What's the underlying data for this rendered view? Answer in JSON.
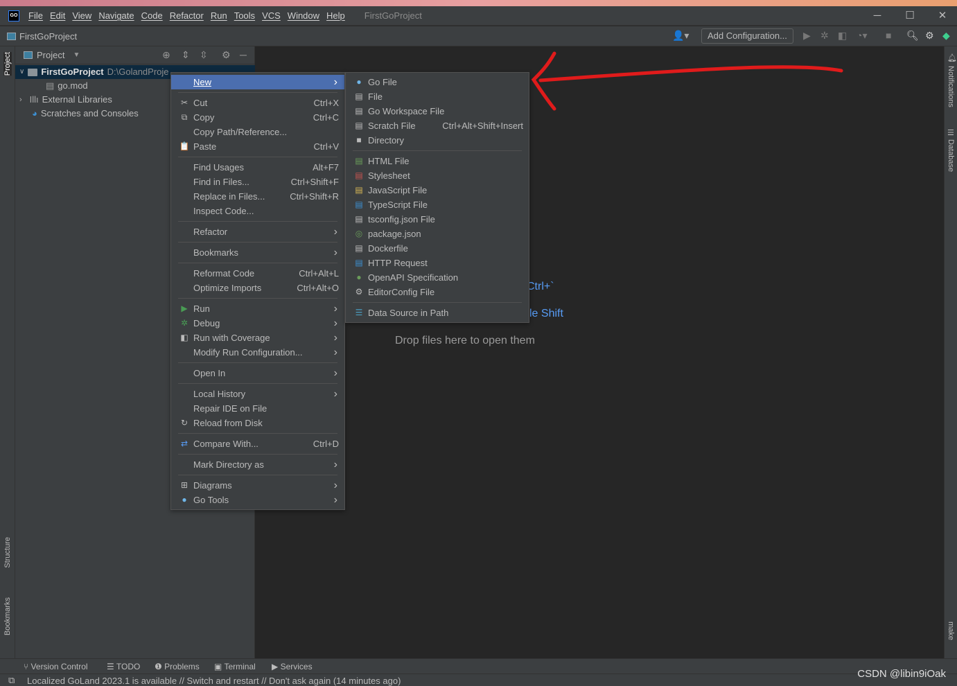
{
  "app": {
    "logo_text": "GO",
    "window_title": "FirstGoProject",
    "accent": "#4b6eaf",
    "annotation_color": "#e01b1b"
  },
  "menubar": [
    "File",
    "Edit",
    "View",
    "Navigate",
    "Code",
    "Refactor",
    "Run",
    "Tools",
    "VCS",
    "Window",
    "Help"
  ],
  "navbar": {
    "project": "FirstGoProject",
    "add_configuration": "Add Configuration..."
  },
  "left_strip": {
    "project": "Project",
    "structure": "Structure",
    "bookmarks": "Bookmarks"
  },
  "right_strip": {
    "notifications": "Notifications",
    "database": "Database",
    "make": "make"
  },
  "project_panel": {
    "title": "Project",
    "tree": [
      {
        "label": "FirstGoProject",
        "path": "D:\\GolandProje",
        "icon": "folder-icon",
        "expanded": true
      },
      {
        "label": "go.mod",
        "icon": "file-icon"
      },
      {
        "label": "External Libraries",
        "icon": "library-icon",
        "expanded": false
      },
      {
        "label": "Scratches and Consoles",
        "icon": "scratches-icon"
      }
    ]
  },
  "context_menu": [
    {
      "label": "New",
      "ul": "N",
      "arrow": true,
      "selected": true
    },
    {
      "sep": true
    },
    {
      "label": "Cut",
      "icon": "✂",
      "name": "cut",
      "shortcut": "Ctrl+X"
    },
    {
      "label": "Copy",
      "icon": "⧉",
      "name": "copy",
      "shortcut": "Ctrl+C"
    },
    {
      "label": "Copy Path/Reference..."
    },
    {
      "label": "Paste",
      "icon": "📋",
      "name": "paste",
      "shortcut": "Ctrl+V"
    },
    {
      "sep": true
    },
    {
      "label": "Find Usages",
      "shortcut": "Alt+F7"
    },
    {
      "label": "Find in Files...",
      "shortcut": "Ctrl+Shift+F"
    },
    {
      "label": "Replace in Files...",
      "shortcut": "Ctrl+Shift+R"
    },
    {
      "label": "Inspect Code..."
    },
    {
      "sep": true
    },
    {
      "label": "Refactor",
      "arrow": true
    },
    {
      "sep": true
    },
    {
      "label": "Bookmarks",
      "arrow": true
    },
    {
      "sep": true
    },
    {
      "label": "Reformat Code",
      "shortcut": "Ctrl+Alt+L"
    },
    {
      "label": "Optimize Imports",
      "shortcut": "Ctrl+Alt+O"
    },
    {
      "sep": true
    },
    {
      "label": "Run",
      "icon": "▶",
      "name": "run",
      "color": "#499c54",
      "arrow": true
    },
    {
      "label": "Debug",
      "icon": "✲",
      "name": "debug",
      "color": "#499c54",
      "arrow": true
    },
    {
      "label": "Run with Coverage",
      "icon": "◧",
      "name": "coverage",
      "arrow": true
    },
    {
      "label": "Modify Run Configuration...",
      "arrow": true
    },
    {
      "sep": true
    },
    {
      "label": "Open In",
      "arrow": true
    },
    {
      "sep": true
    },
    {
      "label": "Local History",
      "arrow": true
    },
    {
      "label": "Repair IDE on File"
    },
    {
      "label": "Reload from Disk",
      "icon": "↻",
      "name": "reload"
    },
    {
      "sep": true
    },
    {
      "label": "Compare With...",
      "icon": "⇄",
      "name": "compare",
      "color": "#589df6",
      "shortcut": "Ctrl+D"
    },
    {
      "sep": true
    },
    {
      "label": "Mark Directory as",
      "arrow": true
    },
    {
      "sep": true
    },
    {
      "label": "Diagrams",
      "icon": "⊞",
      "name": "diagrams",
      "arrow": true
    },
    {
      "label": "Go Tools",
      "icon": "●",
      "name": "gopher",
      "color": "#6fb6e8",
      "arrow": true
    }
  ],
  "new_submenu": [
    {
      "label": "Go File",
      "icon": "●",
      "name": "gopher",
      "color": "#6fb6e8"
    },
    {
      "label": "File",
      "icon": "▤",
      "name": "file"
    },
    {
      "label": "Go Workspace File",
      "icon": "▤",
      "name": "file"
    },
    {
      "label": "Scratch File",
      "icon": "▤",
      "name": "scratch",
      "shortcut": "Ctrl+Alt+Shift+Insert"
    },
    {
      "label": "Directory",
      "icon": "■",
      "name": "folder"
    },
    {
      "sep": true
    },
    {
      "label": "HTML File",
      "icon": "▤",
      "name": "html-file",
      "color": "#6a9c5a"
    },
    {
      "label": "Stylesheet",
      "icon": "▤",
      "name": "css-file",
      "color": "#c75450"
    },
    {
      "label": "JavaScript File",
      "icon": "▤",
      "name": "js-file",
      "color": "#d6b656"
    },
    {
      "label": "TypeScript File",
      "icon": "▤",
      "name": "ts-file",
      "color": "#3d8fd1"
    },
    {
      "label": "tsconfig.json File",
      "icon": "▤",
      "name": "tsconfig-file"
    },
    {
      "label": "package.json",
      "icon": "◎",
      "name": "package-json",
      "color": "#6a9c5a"
    },
    {
      "label": "Dockerfile",
      "icon": "▤",
      "name": "docker-file"
    },
    {
      "label": "HTTP Request",
      "icon": "▤",
      "name": "http-file",
      "color": "#3d8fd1"
    },
    {
      "label": "OpenAPI Specification",
      "icon": "●",
      "name": "openapi",
      "color": "#6a9c5a"
    },
    {
      "label": "EditorConfig File",
      "icon": "⚙",
      "name": "gear"
    },
    {
      "sep": true
    },
    {
      "label": "Data Source in Path",
      "icon": "☰",
      "name": "database",
      "color": "#4a9ec2"
    }
  ],
  "editor": {
    "hint1": "Ctrl+`",
    "hint2": "le Shift",
    "drop": "Drop files here to open them"
  },
  "bottom_tools": [
    "Version Control",
    "TODO",
    "Problems",
    "Terminal",
    "Services"
  ],
  "status": "Localized GoLand 2023.1 is available // Switch and restart // Don't ask again (14 minutes ago)",
  "watermark": "CSDN @libin9iOak"
}
